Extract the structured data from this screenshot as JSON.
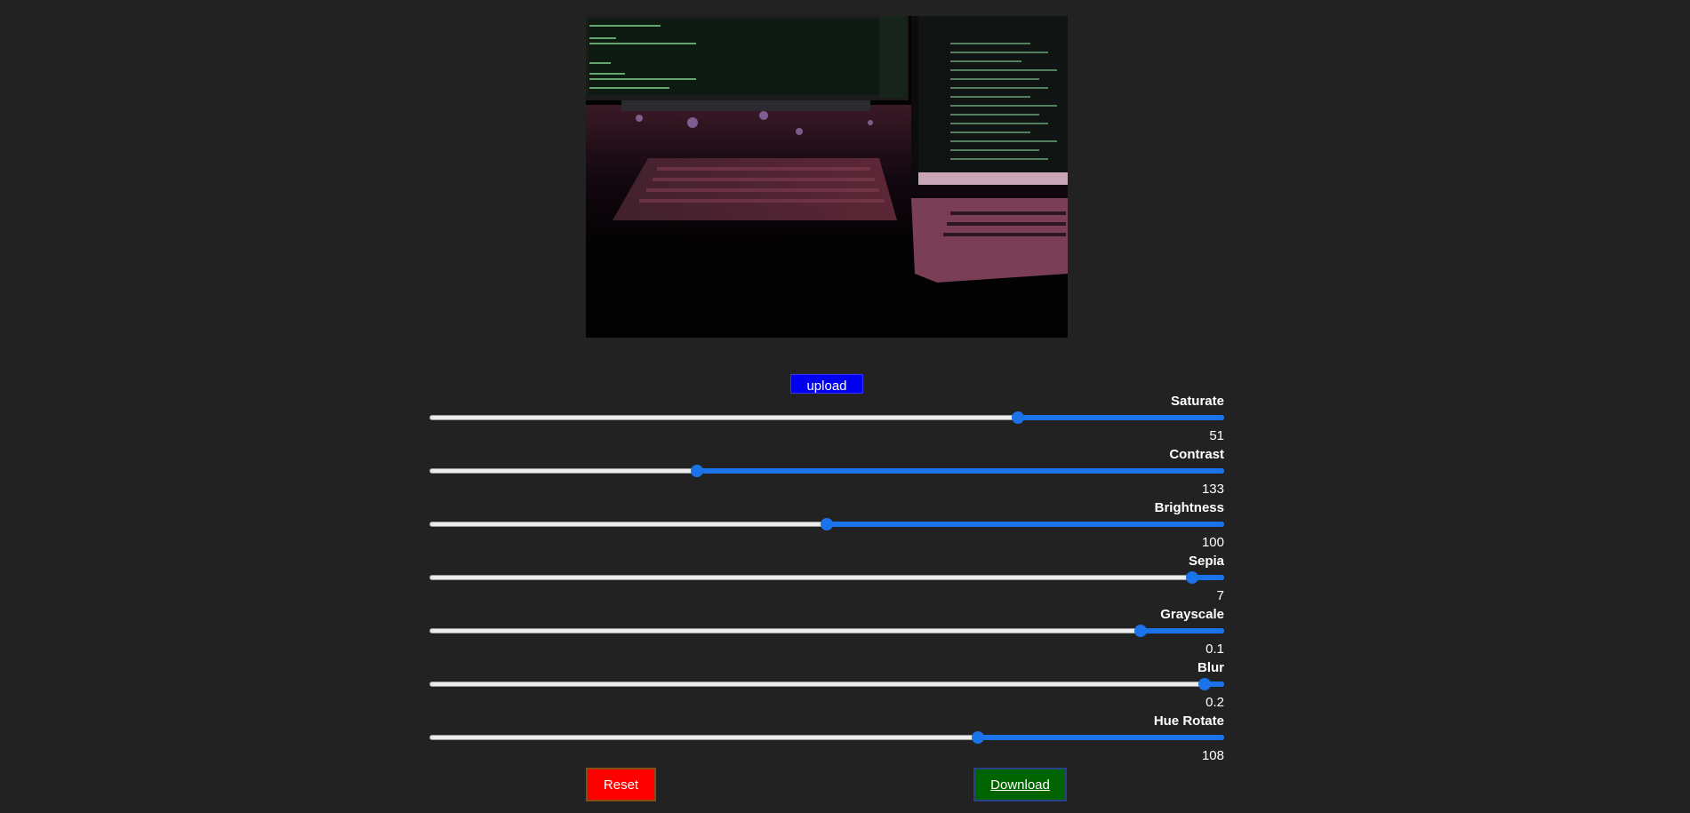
{
  "image": {
    "icon": "photo-preview"
  },
  "upload": {
    "label": "upload"
  },
  "sliders": [
    {
      "label": "Saturate",
      "value": "51",
      "level": 0.74
    },
    {
      "label": "Contrast",
      "value": "133",
      "level": 0.337
    },
    {
      "label": "Brightness",
      "value": "100",
      "level": 0.5
    },
    {
      "label": "Sepia",
      "value": "7",
      "level": 0.96
    },
    {
      "label": "Grayscale",
      "value": "0.1",
      "level": 0.895
    },
    {
      "label": "Blur",
      "value": "0.2",
      "level": 0.975
    },
    {
      "label": "Hue Rotate",
      "value": "108",
      "level": 0.69
    }
  ],
  "buttons": {
    "reset": "Reset",
    "download": "Download"
  },
  "colors": {
    "accent": "#1a73e8",
    "upload": "#0000ee",
    "reset": "#ff0000",
    "download": "#006400",
    "background": "#222222"
  }
}
